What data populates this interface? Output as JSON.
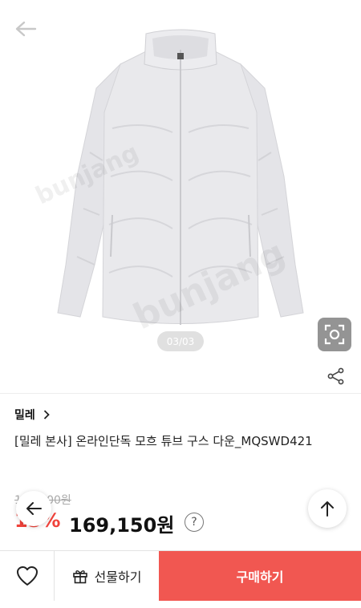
{
  "gallery": {
    "counter": "03/03",
    "watermark": "bunjang"
  },
  "product": {
    "brand": "밀레",
    "title": "[밀레 본사] 온라인단독 모흐 튜브 구스 다운_MQSWD421",
    "original_price": "199,000원",
    "discount": "15%",
    "sale_price": "169,150원"
  },
  "bottom_bar": {
    "gift_label": "선물하기",
    "buy_label": "구매하기"
  },
  "colors": {
    "accent": "#f15751",
    "discount": "#f0433b",
    "jacket": "#e7e7ea"
  },
  "icons": [
    "back-arrow-icon",
    "lens-search-icon",
    "share-icon",
    "chevron-right-icon",
    "info-icon",
    "back-arrow-icon",
    "arrow-up-icon",
    "heart-icon",
    "gift-icon"
  ]
}
